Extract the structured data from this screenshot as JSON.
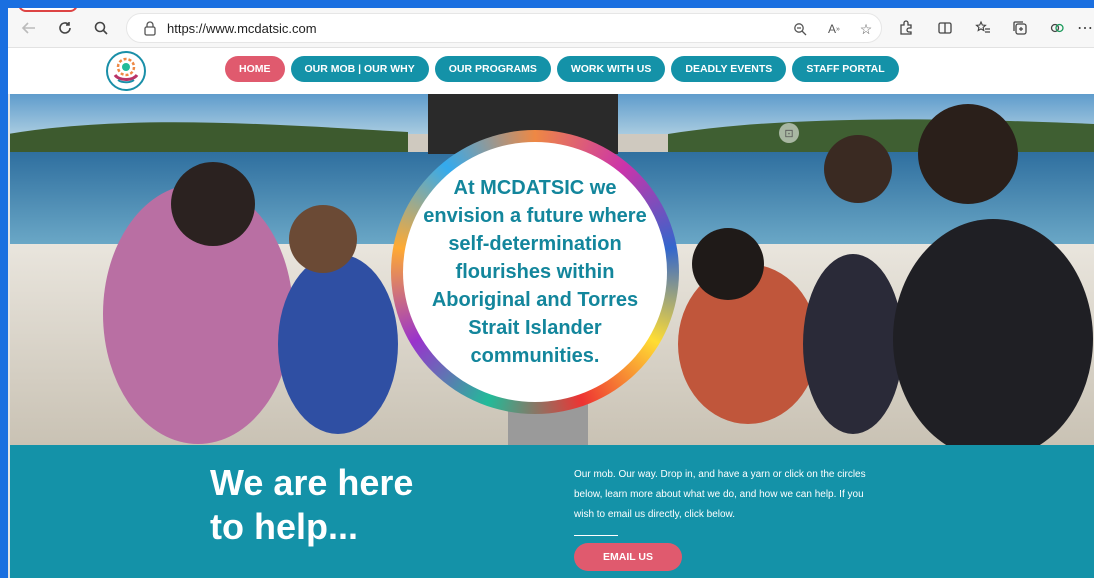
{
  "browser": {
    "url": "https://www.mcdatsic.com",
    "icons": [
      "back-icon",
      "refresh-icon",
      "search-icon",
      "lock-icon",
      "zoom-out-icon",
      "read-aloud-icon",
      "favorite-icon",
      "extensions-icon",
      "split-screen-icon",
      "favorites-list-icon",
      "collections-icon",
      "copilot-icon",
      "more-icon"
    ]
  },
  "nav": {
    "items": [
      "HOME",
      "OUR MOB | OUR WHY",
      "OUR PROGRAMS",
      "WORK WITH US",
      "DEADLY EVENTS",
      "STAFF PORTAL"
    ],
    "active": "HOME",
    "colors": {
      "teal": "#1492a8",
      "pink": "#e05a6e"
    }
  },
  "hero": {
    "circle_lines": [
      "At MCDATSIC we",
      "envision a future where",
      "self-determination",
      "flourishes within",
      "Aboriginal and Torres",
      "Strait Islander",
      "communities."
    ]
  },
  "help": {
    "heading_lines": [
      "We are here",
      "to help..."
    ],
    "body": "Our mob. Our way. Drop in, and have a yarn or click on the circles below, learn more about what we do, and how we can help. If you wish to email us directly, click below.",
    "email_button": "EMAIL US"
  }
}
